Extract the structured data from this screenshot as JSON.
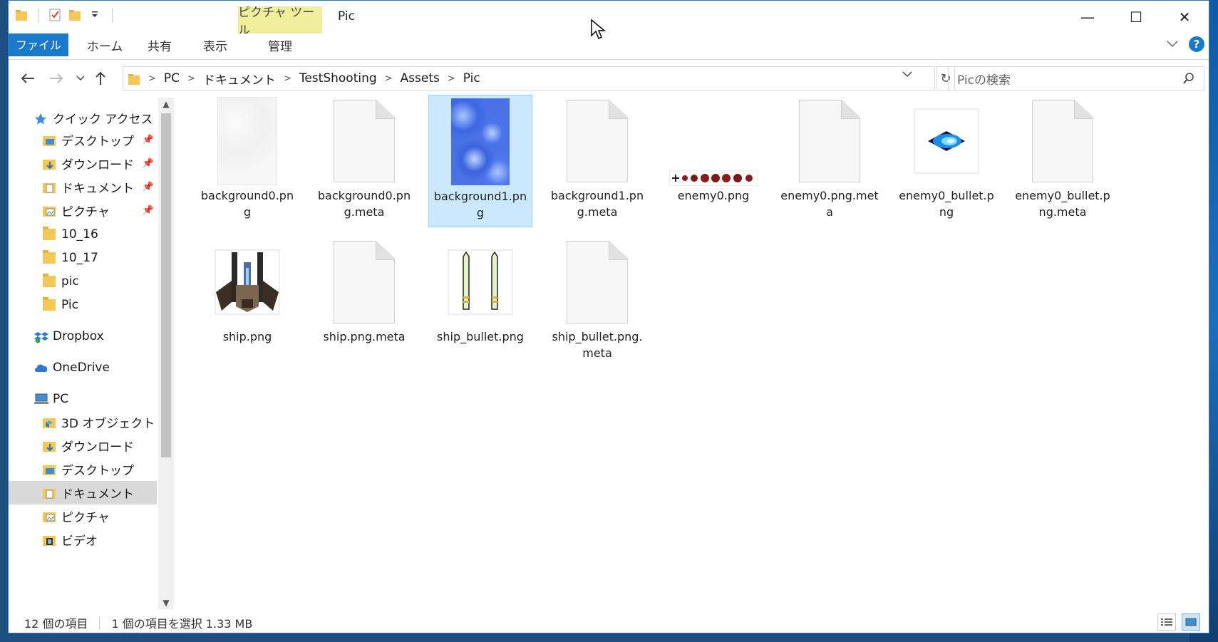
{
  "window": {
    "title": "Pic",
    "context_tab": "ピクチャ ツール",
    "controls": {
      "minimize": "—",
      "maximize": "☐",
      "close": "✕"
    }
  },
  "ribbon": {
    "tabs": [
      "ファイル",
      "ホーム",
      "共有",
      "表示",
      "管理"
    ]
  },
  "address": {
    "crumbs": [
      "PC",
      "ドキュメント",
      "TestShooting",
      "Assets",
      "Pic"
    ],
    "search_placeholder": "Picの検索"
  },
  "nav": {
    "quick_access": "クイック アクセス",
    "quick_items": [
      "デスクトップ",
      "ダウンロード",
      "ドキュメント",
      "ピクチャ",
      "10_16",
      "10_17",
      "pic",
      "Pic"
    ],
    "dropbox": "Dropbox",
    "onedrive": "OneDrive",
    "pc": "PC",
    "pc_items": [
      "3D オブジェクト",
      "ダウンロード",
      "デスクトップ",
      "ドキュメント",
      "ピクチャ",
      "ビデオ"
    ],
    "selected": "ドキュメント"
  },
  "files": [
    {
      "name": "background0.pn g",
      "thumb": "bg0"
    },
    {
      "name": "background0.pn g.meta",
      "thumb": "doc"
    },
    {
      "name": "background1.pn g",
      "thumb": "bg1",
      "selected": true
    },
    {
      "name": "background1.pn g.meta",
      "thumb": "doc"
    },
    {
      "name": "enemy0.png",
      "thumb": "enemy"
    },
    {
      "name": "enemy0.png.met a",
      "thumb": "doc"
    },
    {
      "name": "enemy0_bullet.p ng",
      "thumb": "ebullet"
    },
    {
      "name": "enemy0_bullet.p ng.meta",
      "thumb": "doc"
    },
    {
      "name": "ship.png",
      "thumb": "ship"
    },
    {
      "name": "ship.png.meta",
      "thumb": "doc"
    },
    {
      "name": "ship_bullet.png",
      "thumb": "sbullet"
    },
    {
      "name": "ship_bullet.png. meta",
      "thumb": "doc"
    }
  ],
  "status": {
    "count": "12 個の項目",
    "selection": "1 個の項目を選択  1.33 MB"
  },
  "colors": {
    "accent": "#1979ca",
    "selection": "#cce8ff",
    "context_tab": "#f1ef9c"
  }
}
